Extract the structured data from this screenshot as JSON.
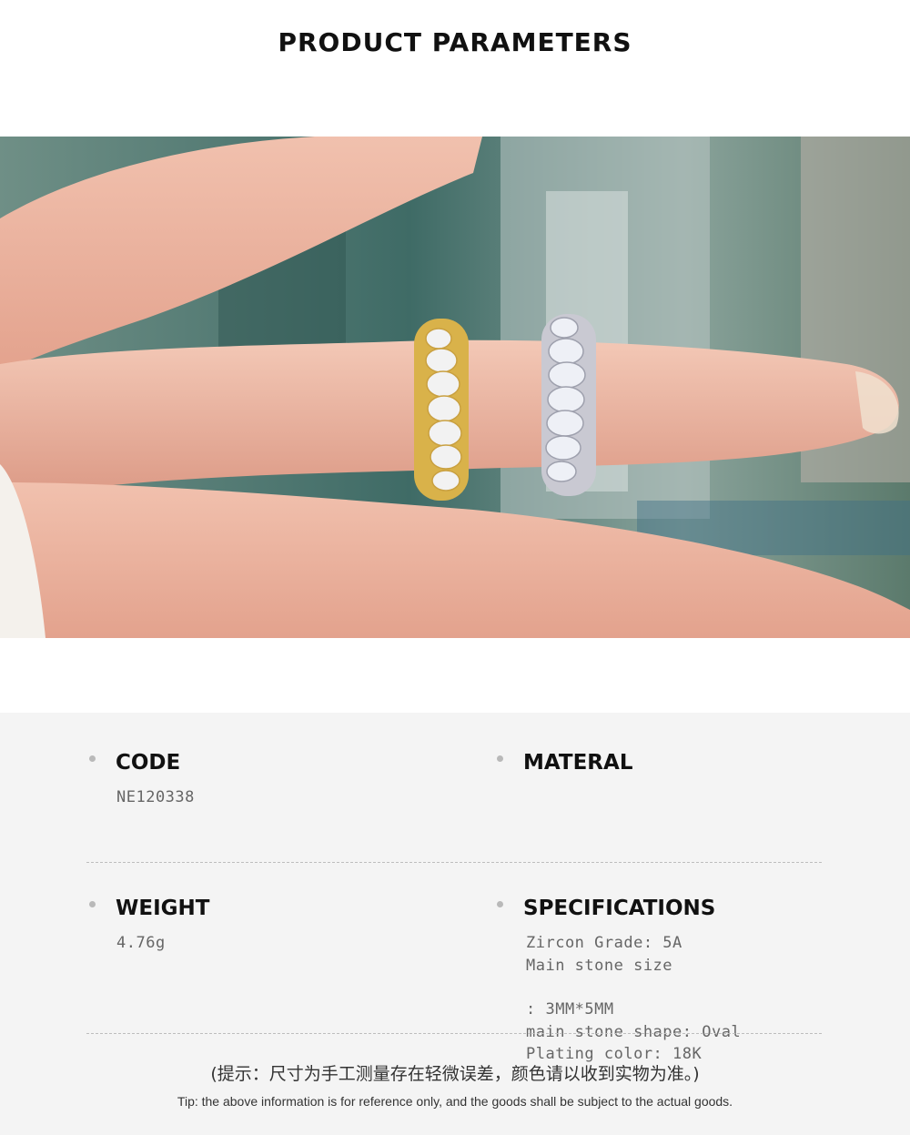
{
  "header": {
    "title": "PRODUCT PARAMETERS"
  },
  "photo": {
    "description_icon": "ring-photo"
  },
  "params": {
    "code": {
      "label": "CODE",
      "value": "NE120338"
    },
    "material": {
      "label": "MATERAL",
      "value": ""
    },
    "weight": {
      "label": "WEIGHT",
      "value": "4.76g"
    },
    "specifications": {
      "label": "SPECIFICATIONS",
      "lines": [
        "Zircon Grade: 5A",
        "Main stone size",
        "",
        ": 3MM*5MM",
        "main stone shape: Oval",
        "Plating color: 18K"
      ]
    }
  },
  "footer": {
    "tip_cn": "(提示：尺寸为手工测量存在轻微误差，颜色请以收到实物为准。)",
    "tip_en": "Tip: the above information is for reference only, and the goods shall be subject to the actual goods."
  },
  "colors": {
    "panel_bg": "#f4f4f4",
    "gold": "#d9b24a",
    "silver": "#c9c9d2"
  }
}
